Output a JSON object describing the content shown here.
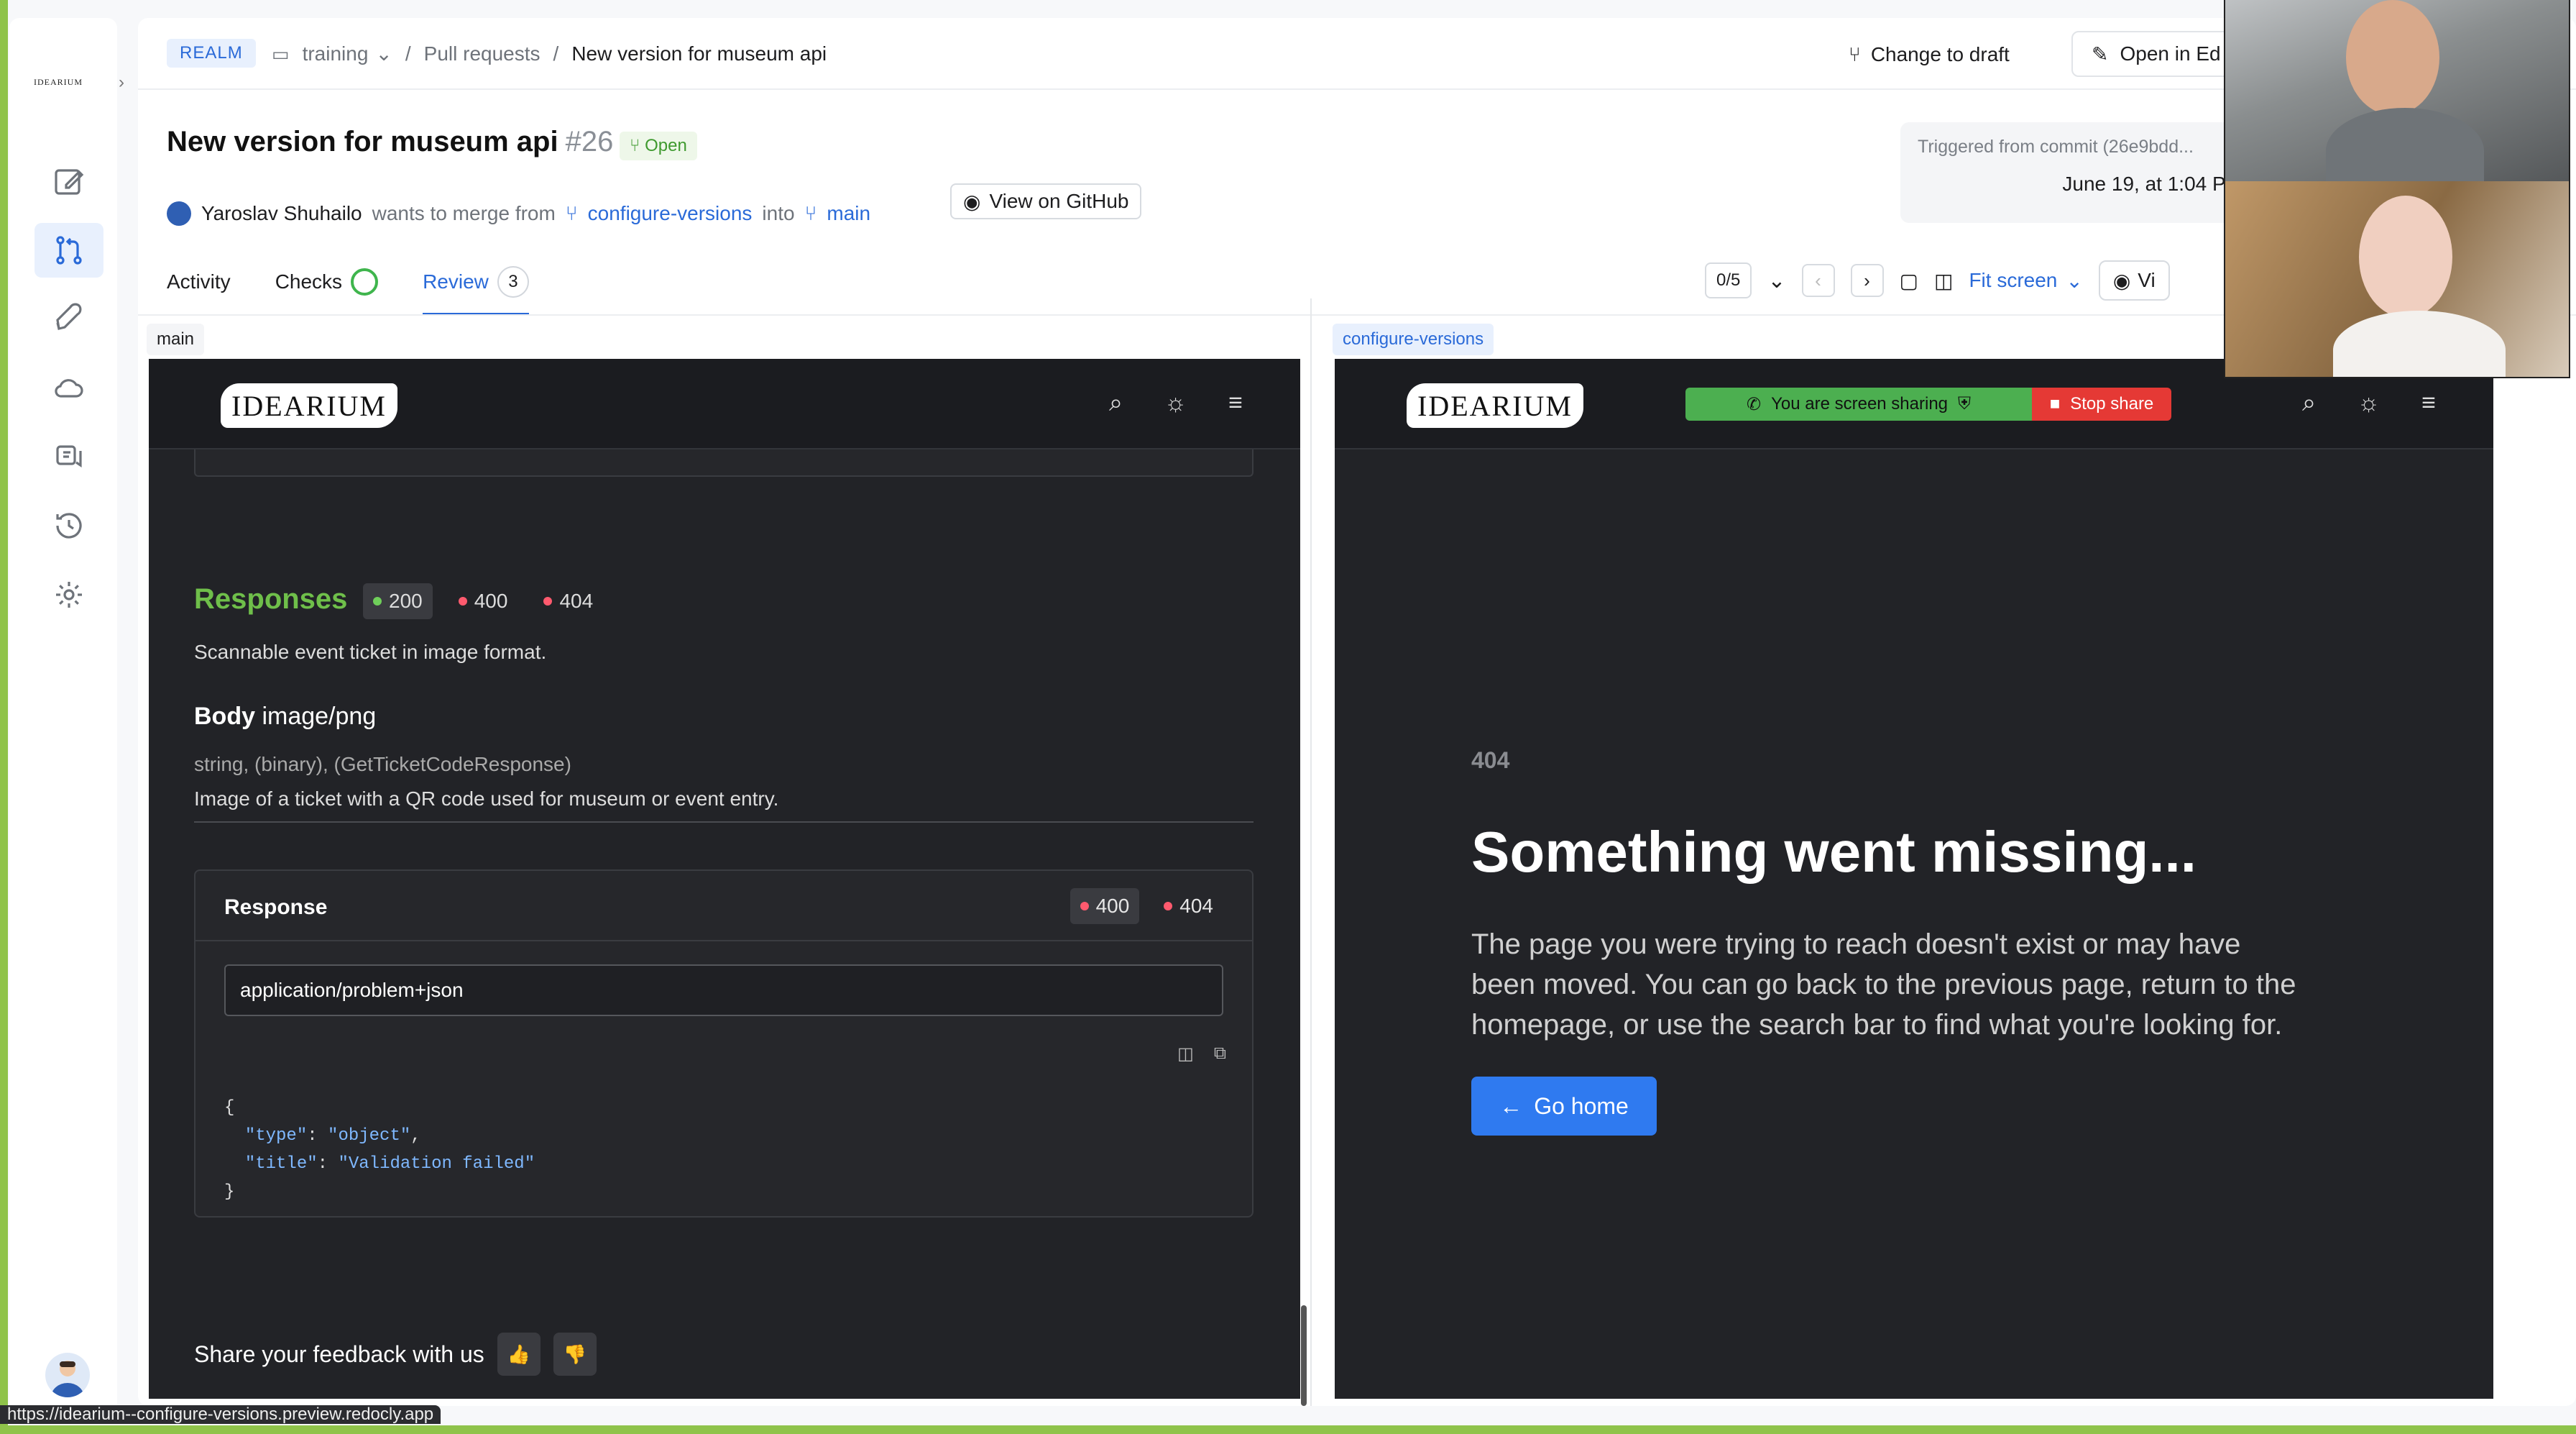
{
  "sidebar": {
    "logo": "IDEARIUM",
    "expand_icon": "chevron-right-icon",
    "items": [
      {
        "icon": "edit-icon",
        "active": false
      },
      {
        "icon": "pull-request-icon",
        "active": true
      },
      {
        "icon": "rocket-icon",
        "active": false
      },
      {
        "icon": "cloud-icon",
        "active": false
      },
      {
        "icon": "comments-icon",
        "active": false
      },
      {
        "icon": "history-icon",
        "active": false
      },
      {
        "icon": "gear-icon",
        "active": false
      }
    ]
  },
  "header": {
    "realm": "REALM",
    "crumbs": [
      "training",
      "Pull requests",
      "New version for museum api"
    ],
    "change_to_draft": "Change to draft",
    "open_in_editor": "Open in Ed"
  },
  "pr": {
    "title": "New version for museum api",
    "number": "#26",
    "status": "Open",
    "author": "Yaroslav Shuhailo",
    "wants": "wants to merge from",
    "from_branch": "configure-versions",
    "into": "into",
    "to_branch": "main",
    "github": "View on GitHub",
    "triggered": "Triggered from commit (26e9bdd...",
    "date": "June 19, at 1:04 PM"
  },
  "tabs": {
    "activity": "Activity",
    "checks": "Checks",
    "review": "Review",
    "review_count": "3"
  },
  "toolbar": {
    "page": "0/5",
    "fit": "Fit screen",
    "view": "Vi"
  },
  "panes": {
    "left_label": "main",
    "right_label": "configure-versions"
  },
  "left": {
    "logo": "IDEARIUM",
    "responses_title": "Responses",
    "codes": [
      "200",
      "400",
      "404"
    ],
    "description": "Scannable event ticket in image format.",
    "body_label": "Body",
    "body_type": "image/png",
    "schema": "string, (binary), (GetTicketCodeResponse)",
    "schema_desc": "Image of a ticket with a QR code used for museum or event entry.",
    "response_label": "Response",
    "response_codes": [
      "400",
      "404"
    ],
    "mime": "application/problem+json",
    "code": {
      "open": "{",
      "k1": "\"type\"",
      "v1": "\"object\"",
      "k2": "\"title\"",
      "v2": "\"Validation failed\"",
      "close": "}"
    },
    "feedback": "Share your feedback with us"
  },
  "right": {
    "logo": "IDEARIUM",
    "sharing": "You are screen sharing",
    "stop": "Stop share",
    "code": "404",
    "heading": "Something went missing...",
    "paragraph": "The page you were trying to reach doesn't exist or may have been moved. You can go back to the previous page, return to the homepage, or use the search bar to find what you're looking for.",
    "button": "Go home"
  },
  "status_url": "https://idearium--configure-versions.preview.redocly.app",
  "colors": {
    "accent": "#2a6ad8",
    "success": "#6fbf4a",
    "danger": "#e53935",
    "frame": "#8fc34a"
  }
}
